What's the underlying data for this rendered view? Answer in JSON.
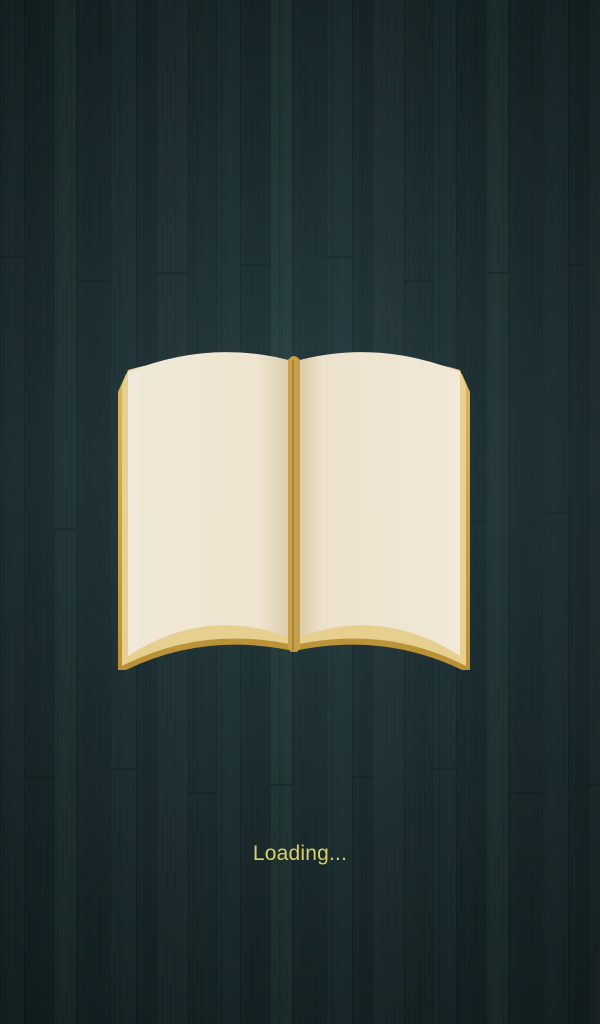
{
  "splash": {
    "background": "dark-teal-wood-planks",
    "logo_icon": "open-book-icon",
    "loading_text": "Loading...",
    "colors": {
      "background": "#22363a",
      "page": "#efe6d5",
      "page_edge": "#c9a44a",
      "loading_text": "#d9cf6a"
    }
  }
}
